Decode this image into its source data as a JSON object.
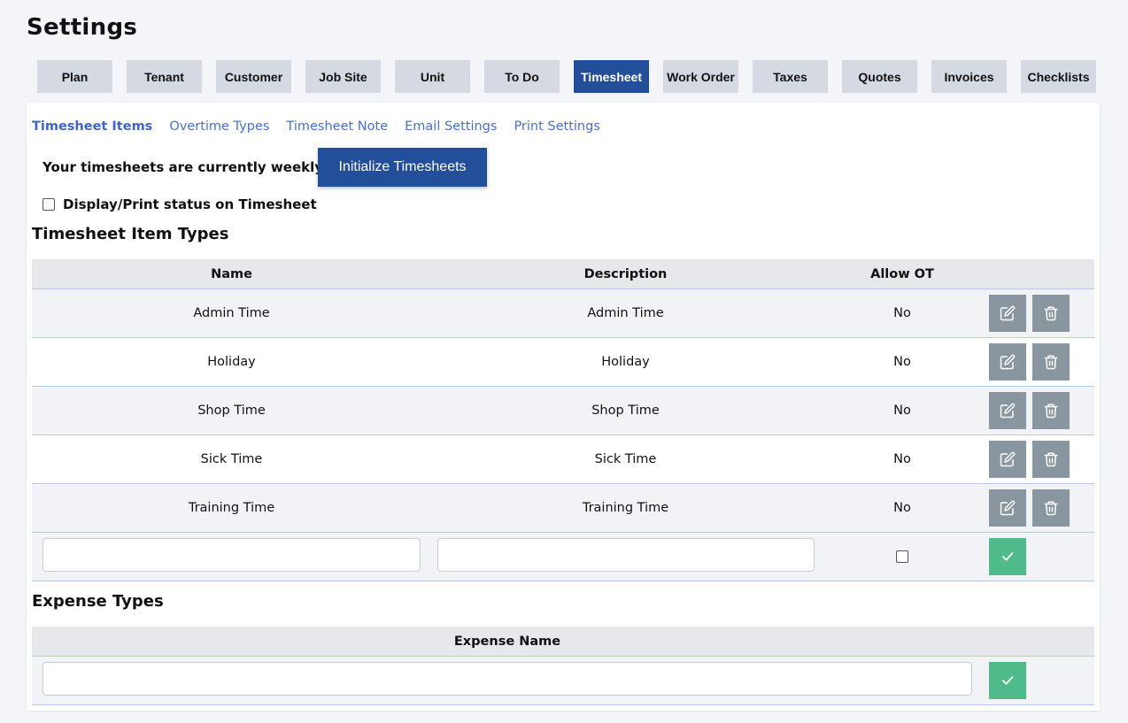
{
  "page": {
    "title": "Settings"
  },
  "tabs": [
    {
      "label": "Plan"
    },
    {
      "label": "Tenant"
    },
    {
      "label": "Customer"
    },
    {
      "label": "Job Site"
    },
    {
      "label": "Unit"
    },
    {
      "label": "To Do"
    },
    {
      "label": "Timesheet",
      "active": true
    },
    {
      "label": "Work Order"
    },
    {
      "label": "Taxes"
    },
    {
      "label": "Quotes"
    },
    {
      "label": "Invoices"
    },
    {
      "label": "Checklists"
    }
  ],
  "subtabs": [
    {
      "label": "Timesheet Items",
      "active": true
    },
    {
      "label": "Overtime Types"
    },
    {
      "label": "Timesheet Note"
    },
    {
      "label": "Email Settings"
    },
    {
      "label": "Print Settings"
    }
  ],
  "timesheet": {
    "frequency_text": "Your timesheets are currently weekly",
    "init_button": "Initialize Timesheets",
    "display_status_label": "Display/Print status on Timesheet",
    "display_status_checked": false
  },
  "item_types": {
    "title": "Timesheet Item Types",
    "headers": {
      "name": "Name",
      "description": "Description",
      "allow_ot": "Allow OT"
    },
    "rows": [
      {
        "name": "Admin Time",
        "description": "Admin Time",
        "allow_ot": "No"
      },
      {
        "name": "Holiday",
        "description": "Holiday",
        "allow_ot": "No"
      },
      {
        "name": "Shop Time",
        "description": "Shop Time",
        "allow_ot": "No"
      },
      {
        "name": "Sick Time",
        "description": "Sick Time",
        "allow_ot": "No"
      },
      {
        "name": "Training Time",
        "description": "Training Time",
        "allow_ot": "No"
      }
    ],
    "new_row": {
      "name": "",
      "description": "",
      "allow_ot_checked": false
    }
  },
  "expense_types": {
    "title": "Expense Types",
    "headers": {
      "name": "Expense Name"
    },
    "new_row": {
      "name": ""
    }
  },
  "icons": {
    "edit": "edit-icon",
    "delete": "trash-icon",
    "confirm": "check-icon"
  },
  "colors": {
    "primary": "#234e99",
    "tab_bg": "#d5dae2",
    "link": "#4a6fd0",
    "action_grey": "#8a969f",
    "confirm_green": "#4fba8a"
  }
}
